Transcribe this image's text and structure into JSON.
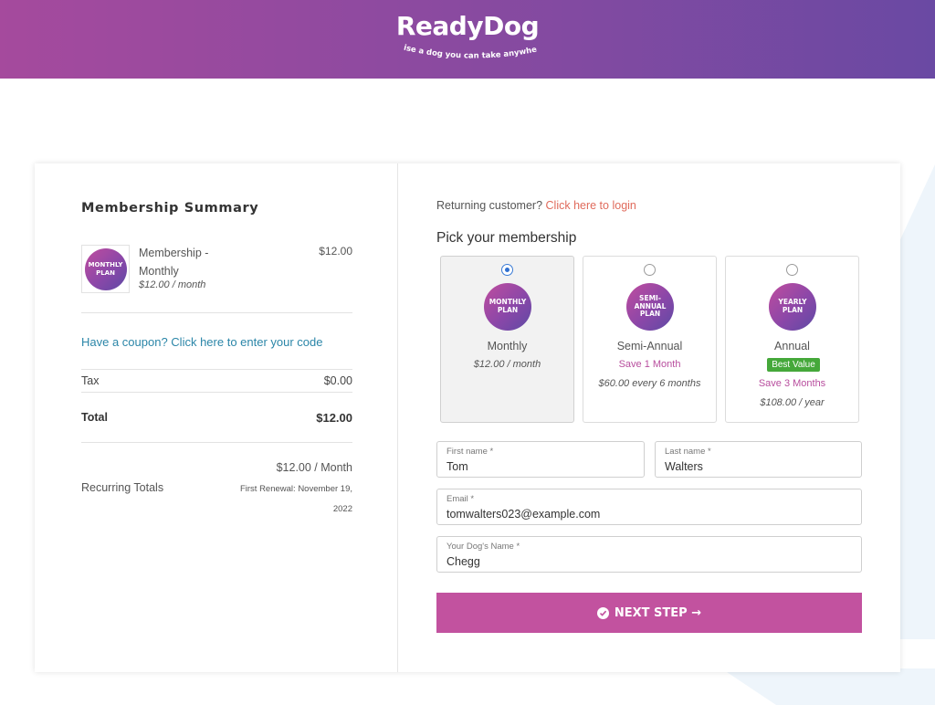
{
  "brand": {
    "name": "ReadyDog",
    "tagline": "raise a dog you can take anywhere"
  },
  "summary": {
    "title": "Membership Summary",
    "item": {
      "badge": "MONTHLY PLAN",
      "name": "Membership - Monthly",
      "price": "$12.00",
      "sub_price": "$12.00",
      "sub_period": " / month"
    },
    "coupon_text": "Have a coupon? Click here to enter your code",
    "tax_label": "Tax",
    "tax_value": "$0.00",
    "total_label": "Total",
    "total_value": "$12.00",
    "recurring_amount": "$12.00 / Month",
    "recurring_label": "Recurring Totals",
    "renewal_line1": "First Renewal: November 19,",
    "renewal_line2": "2022"
  },
  "checkout": {
    "returning_text": "Returning customer? ",
    "login_link": "Click here to login",
    "pick_title": "Pick your membership",
    "plans": [
      {
        "badge": "MONTHLY PLAN",
        "name": "Monthly",
        "save": "",
        "best": "",
        "price": "$12.00",
        "period": " / month",
        "selected": true
      },
      {
        "badge": "SEMI-ANNUAL PLAN",
        "name": "Semi-Annual",
        "save": "Save 1 Month",
        "best": "",
        "price": "$60.00",
        "period": " every 6 months",
        "selected": false
      },
      {
        "badge": "YEARLY PLAN",
        "name": "Annual",
        "save": "Save 3 Months",
        "best": "Best Value",
        "price": "$108.00",
        "period": " / year",
        "selected": false
      }
    ],
    "fields": {
      "first_name": {
        "label": "First name *",
        "value": "Tom"
      },
      "last_name": {
        "label": "Last name *",
        "value": "Walters"
      },
      "email": {
        "label": "Email *",
        "value": "tomwalters023@example.com"
      },
      "dog_name": {
        "label": "Your Dog's Name *",
        "value": "Chegg"
      }
    },
    "next_button": "NEXT STEP →"
  },
  "colors": {
    "header_start": "#a54a9d",
    "header_end": "#6a49a3",
    "button": "#c2529f",
    "link": "#2b86a8",
    "login_link": "#e06b5c",
    "best_value": "#45a83a"
  }
}
